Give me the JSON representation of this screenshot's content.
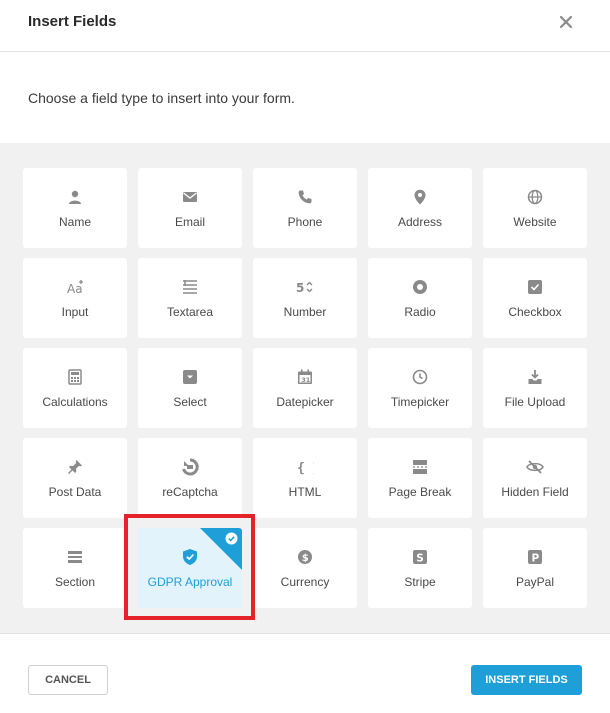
{
  "dialog": {
    "title": "Insert Fields",
    "description": "Choose a field type to insert into your form."
  },
  "fields": [
    {
      "label": "Name",
      "icon": "person-icon"
    },
    {
      "label": "Email",
      "icon": "envelope-icon"
    },
    {
      "label": "Phone",
      "icon": "phone-icon"
    },
    {
      "label": "Address",
      "icon": "map-pin-icon"
    },
    {
      "label": "Website",
      "icon": "globe-icon"
    },
    {
      "label": "Input",
      "icon": "text-input-icon"
    },
    {
      "label": "Textarea",
      "icon": "textarea-icon"
    },
    {
      "label": "Number",
      "icon": "number-icon"
    },
    {
      "label": "Radio",
      "icon": "radio-icon"
    },
    {
      "label": "Checkbox",
      "icon": "checkbox-icon"
    },
    {
      "label": "Calculations",
      "icon": "calculator-icon"
    },
    {
      "label": "Select",
      "icon": "select-icon"
    },
    {
      "label": "Datepicker",
      "icon": "calendar-icon"
    },
    {
      "label": "Timepicker",
      "icon": "clock-icon"
    },
    {
      "label": "File Upload",
      "icon": "upload-icon"
    },
    {
      "label": "Post Data",
      "icon": "pin-icon"
    },
    {
      "label": "reCaptcha",
      "icon": "recaptcha-icon"
    },
    {
      "label": "HTML",
      "icon": "code-braces-icon"
    },
    {
      "label": "Page Break",
      "icon": "page-break-icon"
    },
    {
      "label": "Hidden Field",
      "icon": "eye-off-icon"
    },
    {
      "label": "Section",
      "icon": "section-icon"
    },
    {
      "label": "GDPR Approval",
      "icon": "shield-check-icon"
    },
    {
      "label": "Currency",
      "icon": "dollar-icon"
    },
    {
      "label": "Stripe",
      "icon": "stripe-icon"
    },
    {
      "label": "PayPal",
      "icon": "paypal-icon"
    }
  ],
  "footer": {
    "cancel_label": "CANCEL",
    "insert_label": "INSERT FIELDS"
  }
}
